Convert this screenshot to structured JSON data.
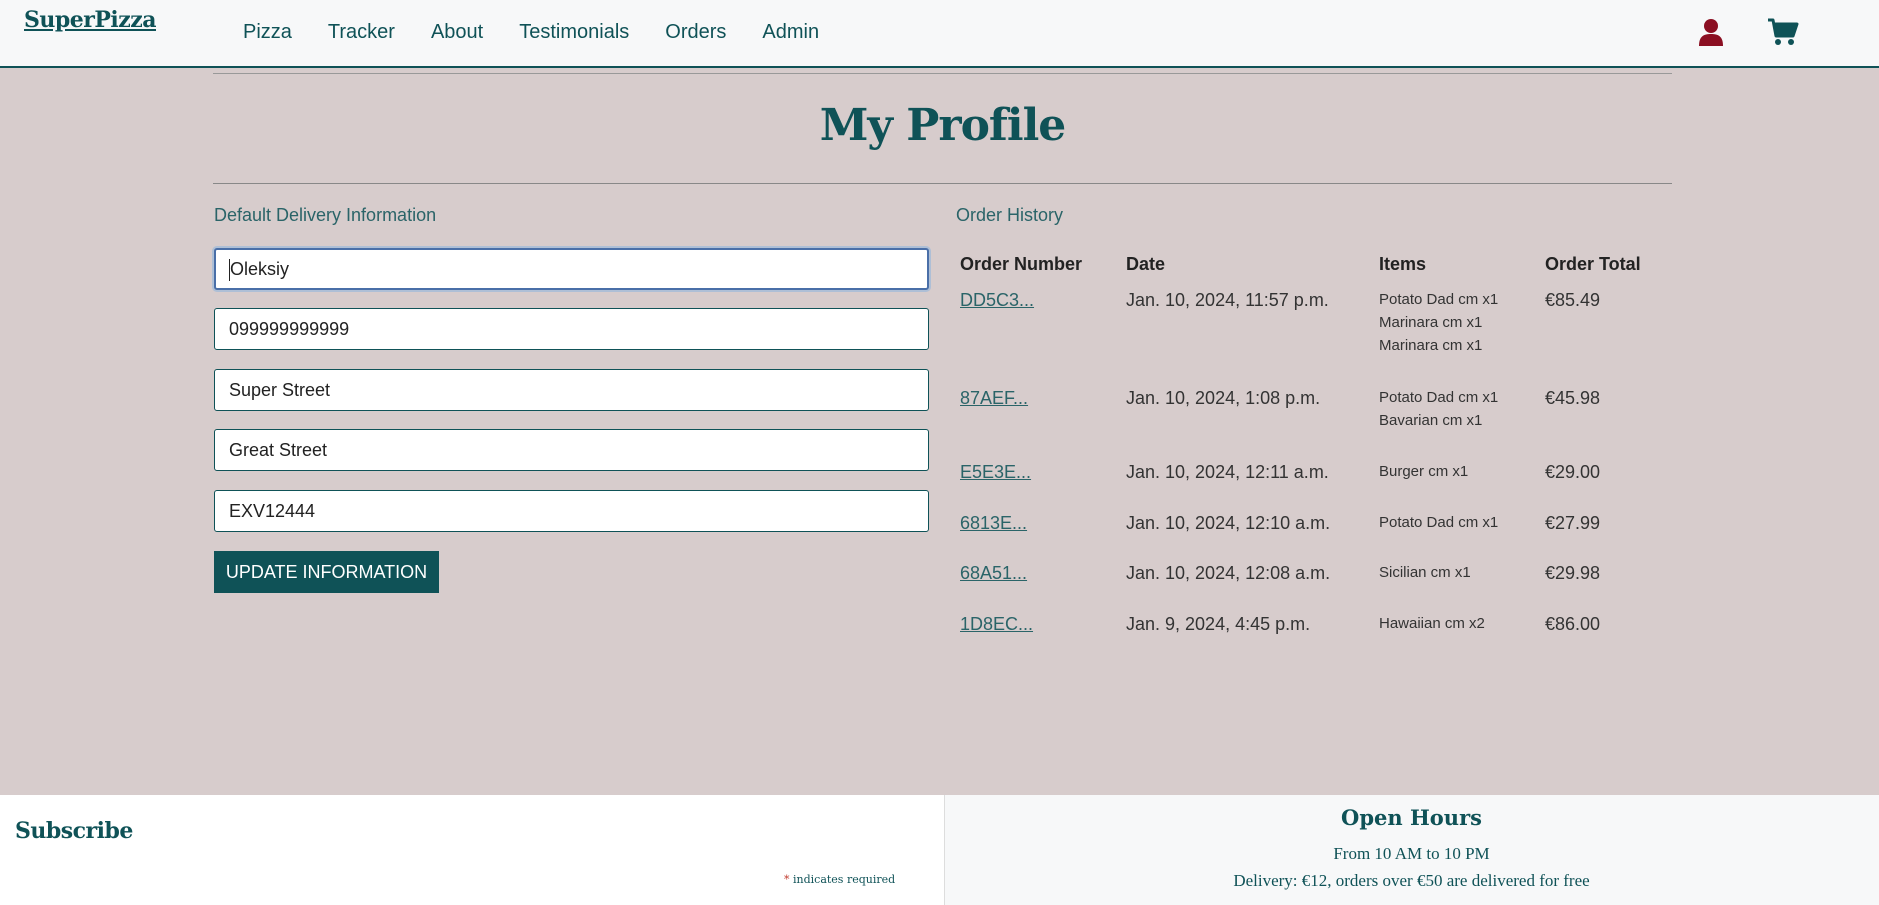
{
  "brand": "SuperPizza",
  "nav": {
    "links": [
      "Pizza",
      "Tracker",
      "About",
      "Testimonials",
      "Orders",
      "Admin"
    ],
    "icons": [
      "user-icon",
      "cart-icon"
    ]
  },
  "colors": {
    "primary": "#0f5257",
    "background": "#d7cccc",
    "user_icon": "#8b0f22"
  },
  "page": {
    "title": "My Profile"
  },
  "delivery": {
    "label": "Default Delivery Information",
    "fields": [
      "Oleksiy",
      "099999999999",
      "Super Street",
      "Great Street",
      "EXV12444"
    ],
    "button": "UPDATE INFORMATION"
  },
  "orders": {
    "label": "Order History",
    "headers": [
      "Order Number",
      "Date",
      "Items",
      "Order Total"
    ],
    "rows": [
      {
        "number": "DD5C3...",
        "date": "Jan. 10, 2024, 11:57 p.m.",
        "items": [
          "Potato Dad cm x1",
          "Marinara cm x1",
          "Marinara cm x1"
        ],
        "total": "€85.49"
      },
      {
        "number": "87AEF...",
        "date": "Jan. 10, 2024, 1:08 p.m.",
        "items": [
          "Potato Dad cm x1",
          "Bavarian cm x1"
        ],
        "total": "€45.98"
      },
      {
        "number": "E5E3E...",
        "date": "Jan. 10, 2024, 12:11 a.m.",
        "items": [
          "Burger cm x1"
        ],
        "total": "€29.00"
      },
      {
        "number": "6813E...",
        "date": "Jan. 10, 2024, 12:10 a.m.",
        "items": [
          "Potato Dad cm x1"
        ],
        "total": "€27.99"
      },
      {
        "number": "68A51...",
        "date": "Jan. 10, 2024, 12:08 a.m.",
        "items": [
          "Sicilian cm x1"
        ],
        "total": "€29.98"
      },
      {
        "number": "1D8EC...",
        "date": "Jan. 9, 2024, 4:45 p.m.",
        "items": [
          "Hawaiian cm x2"
        ],
        "total": "€86.00"
      }
    ]
  },
  "footer": {
    "subscribe": "Subscribe",
    "required_star": "*",
    "required_note": "indicates required",
    "hours_title": "Open Hours",
    "hours": "From 10 AM to 10 PM",
    "delivery": "Delivery: €12, orders over €50 are delivered for free"
  }
}
